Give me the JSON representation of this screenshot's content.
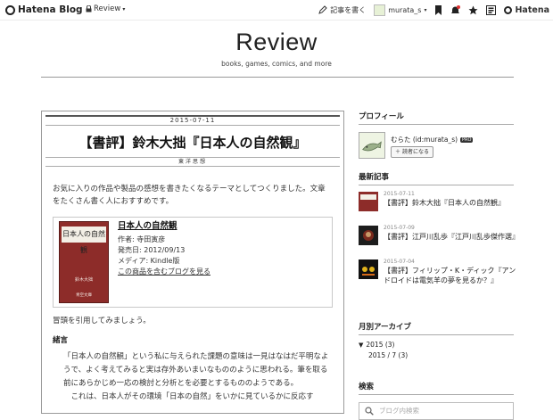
{
  "topbar": {
    "logo_text": "Hatena Blog",
    "blog_selector": "Review",
    "write_label": "記事を書く",
    "username": "murata_s",
    "hatena_text": "Hatena"
  },
  "blog": {
    "title": "Review",
    "description": "books, games, comics, and more"
  },
  "article": {
    "date": "2015-07-11",
    "title": "【書評】鈴木大拙『日本人の自然観』",
    "category": "東洋思想",
    "intro": "お気に入りの作品や製品の感想を書きたくなるテーマとしてつくりました。文章をたくさん書く人におすすめです。",
    "product": {
      "cover_title": "日本人の自然観",
      "cover_author": "鈴木大拙",
      "cover_publisher": "青空文庫",
      "title": "日本人の自然観",
      "author": "作者: 寺田寅彦",
      "date": "発売日: 2012/09/13",
      "media": "メディア: Kindle版",
      "link": "この商品を含むブログを見る"
    },
    "quote_intro": "冒頭を引用してみましょう。",
    "section_heading": "緒言",
    "quote_p1": "「日本人の自然観」という私に与えられた課題の意味は一見はなはだ平明なようで、よく考えてみると実は存外あいまいなもののように思われる。筆を取る前にあらかじめ一応の検討と分析とを必要とするもののようである。",
    "quote_p2": "これは、日本人がその環境「日本の自然」をいかに見ているかに反応す"
  },
  "sidebar": {
    "profile_heading": "プロフィール",
    "profile_name": "むらた (id:murata_s)",
    "pro_badge": "PRO",
    "follow_label": "読者になる",
    "recent_heading": "最新記事",
    "entries": [
      {
        "date": "2015-07-11",
        "title": "【書評】鈴木大拙『日本人の自然観』"
      },
      {
        "date": "2015-07-09",
        "title": "【書評】江戸川乱歩『江戸川乱歩傑作選』"
      },
      {
        "date": "2015-07-04",
        "title": "【書評】フィリップ・K・ディック『アンドロイドは電気羊の夢を見るか？』"
      }
    ],
    "archive_heading": "月別アーカイブ",
    "archive_year": "2015 (3)",
    "archive_month": "2015 / 7 (3)",
    "search_heading": "検索",
    "search_placeholder": "ブログ内検索"
  },
  "colors": {
    "book_cover": "#8d2c29",
    "rule": "#999999"
  }
}
